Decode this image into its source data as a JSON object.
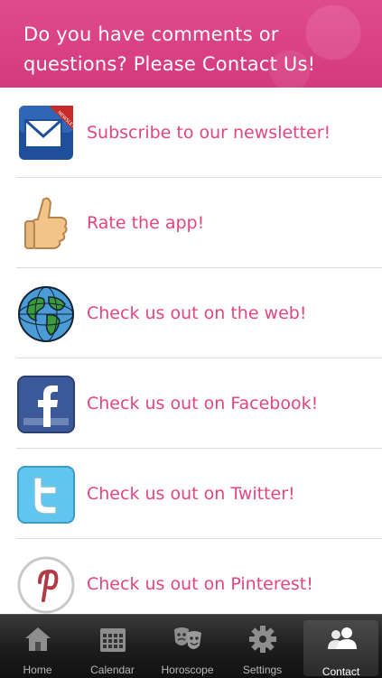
{
  "header": {
    "title": "Do you have comments or questions?  Please Contact Us!"
  },
  "list": {
    "items": [
      {
        "label": "Subscribe to our newsletter!",
        "icon": "newsletter-icon"
      },
      {
        "label": "Rate the app!",
        "icon": "thumbs-up-icon"
      },
      {
        "label": "Check us out on the web!",
        "icon": "globe-icon"
      },
      {
        "label": "Check us out on Facebook!",
        "icon": "facebook-icon"
      },
      {
        "label": "Check us out on Twitter!",
        "icon": "twitter-icon"
      },
      {
        "label": "Check us out on Pinterest!",
        "icon": "pinterest-icon"
      }
    ],
    "newsletter_badge": "NEWSLETTER"
  },
  "tabbar": {
    "tabs": [
      {
        "label": "Home",
        "icon": "home-icon"
      },
      {
        "label": "Calendar",
        "icon": "calendar-icon"
      },
      {
        "label": "Horoscope",
        "icon": "theater-masks-icon"
      },
      {
        "label": "Settings",
        "icon": "gear-icon"
      },
      {
        "label": "Contact",
        "icon": "contacts-icon",
        "active": true
      }
    ]
  },
  "colors": {
    "header_bg": "#d43a7e",
    "label_pink": "#e2457f",
    "tabbar_bg": "#1e1e1e"
  }
}
